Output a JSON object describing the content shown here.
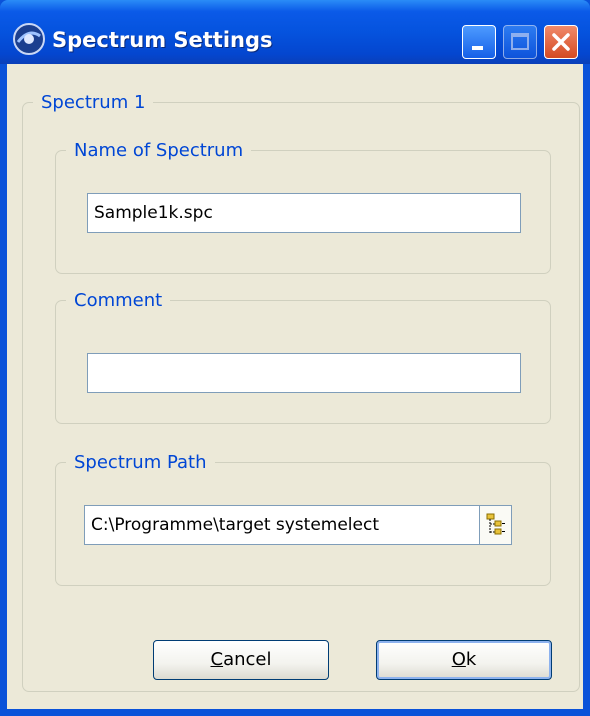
{
  "window": {
    "title": "Spectrum Settings",
    "controls": {
      "minimize": "minimize-icon",
      "maximize": "maximize-icon",
      "close": "close-icon"
    }
  },
  "group": {
    "title": "Spectrum 1",
    "name_section": {
      "legend": "Name of Spectrum",
      "value": "Sample1k.spc"
    },
    "comment_section": {
      "legend": "Comment",
      "value": ""
    },
    "path_section": {
      "legend": "Spectrum Path",
      "value": "C:\\Programme\\target systemelect",
      "browse_icon": "folder-tree-icon"
    }
  },
  "buttons": {
    "cancel": {
      "mnemonic": "C",
      "rest": "ancel"
    },
    "ok": {
      "mnemonic": "O",
      "rest": "k"
    }
  },
  "colors": {
    "title_bar": "#0553de",
    "legend_text": "#0046d5",
    "dialog_bg": "#ece9d8",
    "close_button": "#d44a22"
  }
}
